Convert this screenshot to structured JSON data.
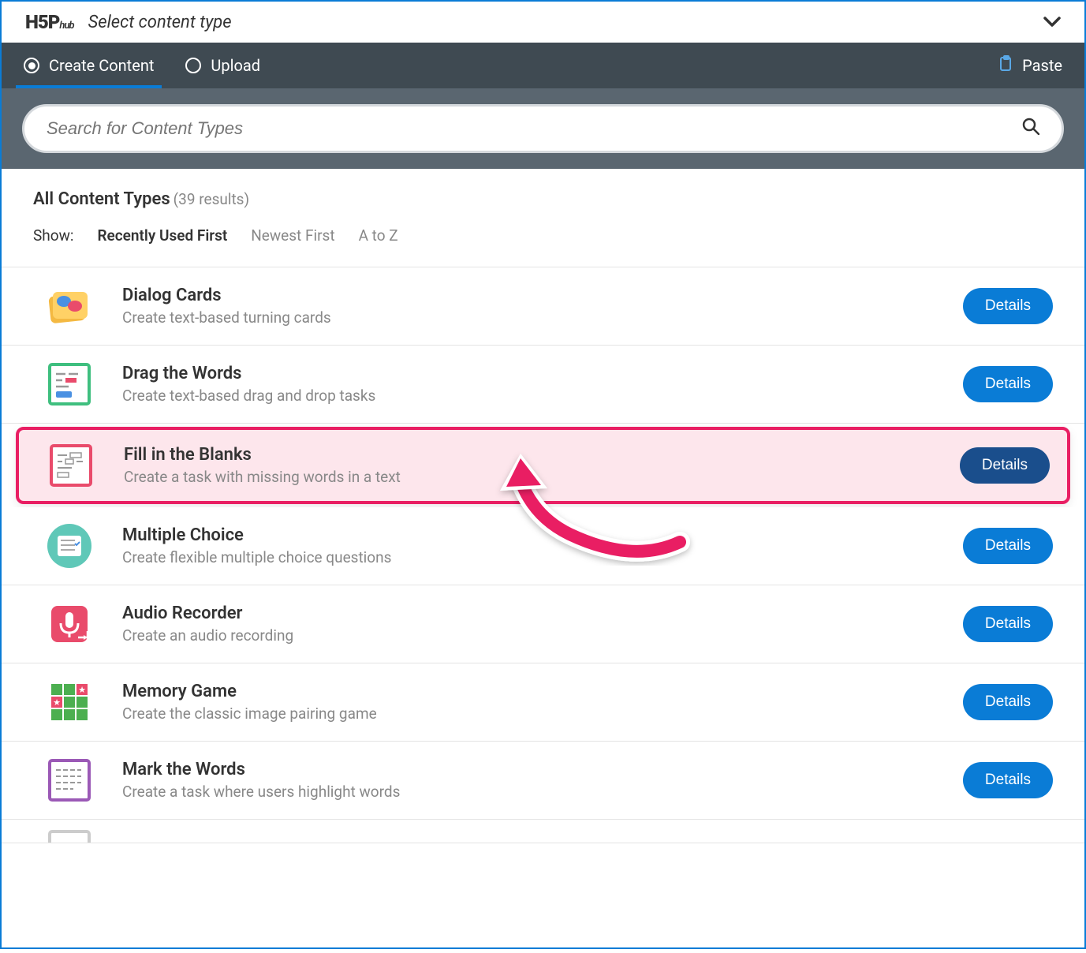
{
  "header": {
    "logo": "H5Phub",
    "title": "Select content type"
  },
  "tabs": {
    "create_label": "Create Content",
    "upload_label": "Upload",
    "paste_label": "Paste"
  },
  "search": {
    "placeholder": "Search for Content Types"
  },
  "results": {
    "title": "All Content Types",
    "count_label": "(39 results)",
    "show_label": "Show:",
    "sort_options": {
      "recent": "Recently Used First",
      "newest": "Newest First",
      "atoz": "A to Z"
    }
  },
  "details_label": "Details",
  "items": [
    {
      "title": "Dialog Cards",
      "desc": "Create text-based turning cards",
      "highlighted": false
    },
    {
      "title": "Drag the Words",
      "desc": "Create text-based drag and drop tasks",
      "highlighted": false
    },
    {
      "title": "Fill in the Blanks",
      "desc": "Create a task with missing words in a text",
      "highlighted": true
    },
    {
      "title": "Multiple Choice",
      "desc": "Create flexible multiple choice questions",
      "highlighted": false
    },
    {
      "title": "Audio Recorder",
      "desc": "Create an audio recording",
      "highlighted": false
    },
    {
      "title": "Memory Game",
      "desc": "Create the classic image pairing game",
      "highlighted": false
    },
    {
      "title": "Mark the Words",
      "desc": "Create a task where users highlight words",
      "highlighted": false
    }
  ]
}
